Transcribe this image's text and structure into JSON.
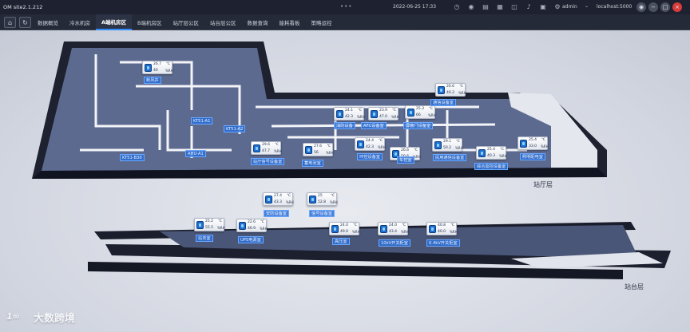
{
  "app": {
    "title": "OM site2.1.212",
    "datetime": "2022-06-25 17:33",
    "user": "admin",
    "host": "localhost:5000",
    "status_dots": "•••"
  },
  "toolbar_icons": [
    "clock-icon",
    "camera-icon",
    "terminal-icon",
    "calendar-icon",
    "document-icon",
    "bell-icon",
    "folder-icon",
    "settings-icon"
  ],
  "window_buttons": [
    "eye-icon",
    "minimize-icon",
    "restore-icon",
    "close-icon"
  ],
  "tabs": [
    {
      "label": "数据概览",
      "active": false
    },
    {
      "label": "冷水机房",
      "active": false
    },
    {
      "label": "A端机房区",
      "active": true
    },
    {
      "label": "B端机房区",
      "active": false
    },
    {
      "label": "站厅层公区",
      "active": false
    },
    {
      "label": "站台层公区",
      "active": false
    },
    {
      "label": "数据查询",
      "active": false
    },
    {
      "label": "能耗看板",
      "active": false
    },
    {
      "label": "策略运控",
      "active": false
    }
  ],
  "sensors": [
    {
      "temp": "26.7",
      "hum": "40"
    },
    {
      "temp": "26.6",
      "hum": "40.2"
    },
    {
      "temp": "24.1",
      "hum": "42.3"
    },
    {
      "temp": "23.9",
      "hum": "47.0"
    },
    {
      "temp": "25.3",
      "hum": "66"
    },
    {
      "temp": "25.4",
      "hum": "33.0"
    },
    {
      "temp": "29.6",
      "hum": "47.7"
    },
    {
      "temp": "27.6",
      "hum": "56"
    },
    {
      "temp": "24.4",
      "hum": "42.3"
    },
    {
      "temp": "26.6",
      "hum": "50.6"
    },
    {
      "temp": "29.1",
      "hum": "50.2"
    },
    {
      "temp": "25.4",
      "hum": "40.3"
    },
    {
      "temp": "27.4",
      "hum": "43.3"
    },
    {
      "temp": "25",
      "hum": "52.8"
    },
    {
      "temp": "25.2",
      "hum": "55.5"
    },
    {
      "temp": "22.6",
      "hum": "46.9"
    },
    {
      "temp": "24.0",
      "hum": "49.0"
    },
    {
      "temp": "24.0",
      "hum": "43.4"
    },
    {
      "temp": "40.8",
      "hum": "40.0"
    }
  ],
  "units": {
    "temp": "℃",
    "hum": "%RH"
  },
  "rooms": [
    "新风井",
    "KT51-A1",
    "KT51-A2",
    "KT51-B30",
    "AHU-A1",
    "AFC设备室",
    "消防设备",
    "屏蔽门设备室",
    "通信设备室",
    "站厅信号设备室",
    "蓄电池室",
    "环控设备室",
    "综合监控设备室",
    "照明配电室",
    "安防设备室",
    "站务室",
    "民用通信设备室",
    "信号设备室",
    "UPS电源室",
    "高压室",
    "车控室",
    "10kV开关柜室",
    "0.4kV开关柜室"
  ],
  "floors": {
    "hall": "站厅层",
    "platform": "站台层"
  },
  "watermark": {
    "logo": "1∞",
    "text": "大数跨境"
  }
}
